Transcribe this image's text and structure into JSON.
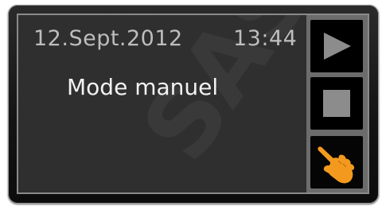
{
  "status_bar": {
    "date": "12.Sept.2012",
    "time": "13:44"
  },
  "main": {
    "mode_label": "Mode manuel"
  },
  "side_buttons": [
    {
      "name": "play",
      "icon": "play-icon"
    },
    {
      "name": "stop",
      "icon": "stop-icon"
    },
    {
      "name": "manual",
      "icon": "hand-pointer-icon"
    }
  ],
  "colors": {
    "screen_bg": "#2f2f2f",
    "panel_bg": "#6c6c6c",
    "icon_gray": "#8c8c8c",
    "hand_orange": "#f39a1e"
  },
  "watermark": "SAS"
}
